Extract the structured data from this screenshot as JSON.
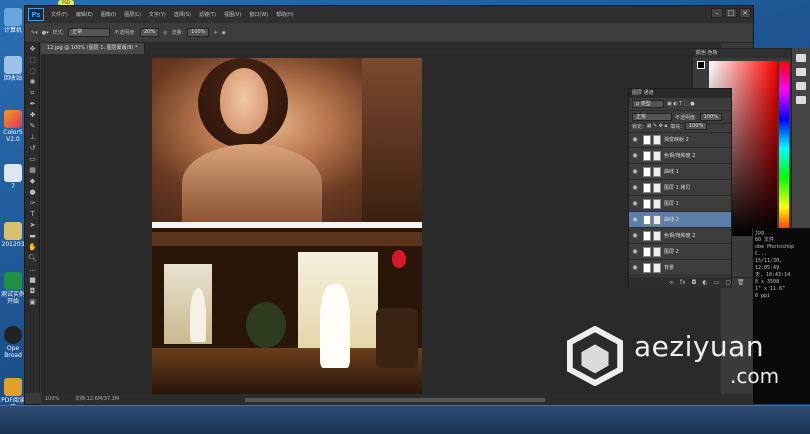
{
  "app": {
    "logo": "Ps",
    "top_pill": "PSD"
  },
  "menu": [
    "文件(F)",
    "编辑(E)",
    "图像(I)",
    "图层(L)",
    "文字(Y)",
    "选择(S)",
    "滤镜(T)",
    "视图(V)",
    "窗口(W)",
    "帮助(H)"
  ],
  "window_buttons": [
    "–",
    "□",
    "×"
  ],
  "options": {
    "style_label": "样式:",
    "style_value": "正常",
    "opacity_label": "不透明度:",
    "opacity_value": "20%",
    "flow_label": "流量:",
    "flow_value": "100%"
  },
  "document_tab": "12.jpg @ 100% (图层 1, 图层蒙版/8) *",
  "status": {
    "zoom": "100%",
    "doc": "文档:12.6M/37.3M"
  },
  "color_panel": {
    "tabs": "颜色  色板"
  },
  "layers_panel": {
    "tabs": "图层  通道",
    "filter_label": "ρ 类型",
    "blend_mode": "正常",
    "opacity_label": "不透明度:",
    "opacity_value": "100%",
    "lock_label": "锁定:",
    "fill_label": "填充:",
    "fill_value": "100%",
    "layers": [
      {
        "name": "渐变映射 2",
        "selected": false
      },
      {
        "name": "色相/饱和度 2",
        "selected": false
      },
      {
        "name": "曲线 1",
        "selected": false
      },
      {
        "name": "图层 1 拷贝",
        "selected": false
      },
      {
        "name": "图层 1",
        "selected": false
      },
      {
        "name": "曲线 2",
        "selected": true
      },
      {
        "name": "色相/饱和度 2",
        "selected": false
      },
      {
        "name": "图层 2",
        "selected": false
      },
      {
        "name": "背景",
        "selected": false
      }
    ]
  },
  "desktop_icons": [
    "计算机",
    "回收站",
    "ColorS V2.0",
    "7",
    "201203",
    "测试实例 开始",
    "Ope Broad",
    "PDF阅读 器"
  ],
  "cmd_text": [
    "jpg",
    "60 文件",
    "obe Photoshop C...",
    "15/11/30, 12:05:49",
    "天, 10:43:14",
    "0 x 3508",
    "1\" x 11.6\"",
    "0 ppi"
  ],
  "watermark": {
    "name": "aeziyuan",
    "domain": ".com"
  }
}
